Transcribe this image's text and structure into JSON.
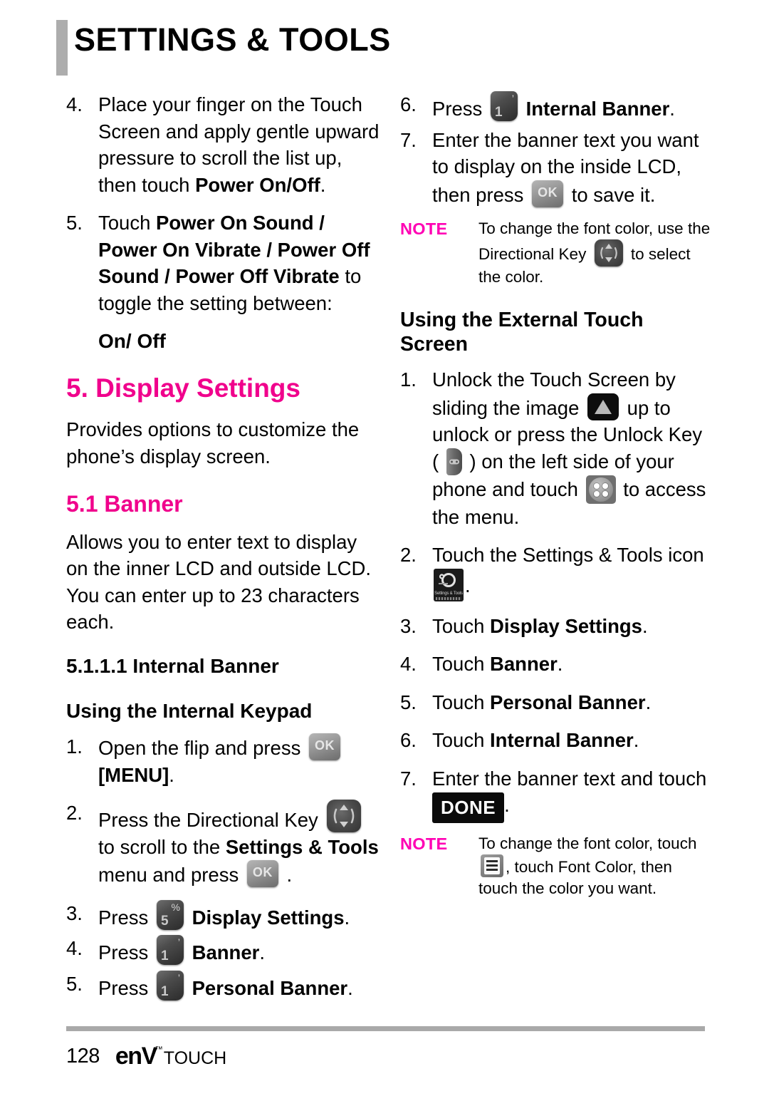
{
  "header": {
    "title": "SETTINGS & TOOLS"
  },
  "colors": {
    "accent_magenta": "#F0008C",
    "note_magenta": "#FF00B4",
    "rule_gray": "#A9A9A9"
  },
  "icons": {
    "key_1": {
      "main": "1",
      "sup": "’"
    },
    "key_5": {
      "main": "5",
      "sup": "%"
    },
    "key_ok": {
      "label": "OK"
    },
    "directional_key": "directional-key",
    "unlock_slider": "unlock-slider-triangle",
    "unlock_key": "unlock-key",
    "menu_circle": "menu-circle-four-dots",
    "settings_tools_app": {
      "label": "Settings & Tools"
    },
    "list_menu": "list-menu"
  },
  "left_column": {
    "step4": {
      "num": "4.",
      "t1": "Place your finger on the Touch Screen and apply gentle upward pressure to scroll the list up, then touch ",
      "b1": "Power On/Off",
      "t2": "."
    },
    "step5": {
      "num": "5.",
      "t1": "Touch ",
      "b1": "Power On Sound / Power On Vibrate / Power Off Sound / Power Off Vibrate",
      "t2": " to toggle the setting between:"
    },
    "on_off": "On/ Off",
    "heading_display_settings": "5. Display Settings",
    "display_settings_desc": "Provides options to customize the phone’s display screen.",
    "heading_banner": "5.1 Banner",
    "banner_desc": "Allows you to enter text to display on the inner LCD and outside LCD. You can enter up to 23 characters each.",
    "heading_internal_banner": "5.1.1.1 Internal Banner",
    "heading_using_internal_keypad": "Using the Internal Keypad",
    "k1": {
      "num": "1.",
      "t1": "Open the flip and press ",
      "t2": "",
      "b1": "[MENU]",
      "t3": "."
    },
    "k2": {
      "num": "2.",
      "t1": "Press the Directional Key ",
      "t2": " to scroll to the ",
      "b1": "Settings & Tools",
      "t3": " menu and press ",
      "t4": " ."
    },
    "k3": {
      "num": "3.",
      "t1": "Press ",
      "b1": "Display Settings",
      "t2": "."
    },
    "k4": {
      "num": "4.",
      "t1": "Press ",
      "b1": "Banner",
      "t2": "."
    },
    "k5": {
      "num": "5.",
      "t1": "Press ",
      "b1": "Personal Banner",
      "t2": "."
    }
  },
  "right_column": {
    "k6": {
      "num": "6.",
      "t1": "Press ",
      "b1": "Internal Banner",
      "t2": "."
    },
    "k7": {
      "num": "7.",
      "t1": "Enter the banner text you want to display on the inside LCD, then press ",
      "t2": " to save it."
    },
    "note1": {
      "tag": "NOTE",
      "t1": "To change the font color, use the Directional Key ",
      "t2": " to select the color."
    },
    "heading_external": "Using the External Touch Screen",
    "e1": {
      "num": "1.",
      "t1": "Unlock the Touch Screen by sliding the image ",
      "t2": " up to unlock or press the Unlock Key ( ",
      "t3": " ) on the left side of your phone and touch ",
      "t4": " to access the menu."
    },
    "e2": {
      "num": "2.",
      "t1": "Touch the Settings & Tools icon ",
      "t2": "."
    },
    "e3": {
      "num": "3.",
      "t1": "Touch ",
      "b1": "Display Settings",
      "t2": "."
    },
    "e4": {
      "num": "4.",
      "t1": "Touch ",
      "b1": "Banner",
      "t2": "."
    },
    "e5": {
      "num": "5.",
      "t1": "Touch ",
      "b1": "Personal Banner",
      "t2": "."
    },
    "e6": {
      "num": "6.",
      "t1": "Touch ",
      "b1": "Internal Banner",
      "t2": "."
    },
    "e7": {
      "num": "7.",
      "t1": "Enter the banner text and touch ",
      "done": "DONE",
      "t2": "."
    },
    "note2": {
      "tag": "NOTE",
      "t1": "To change the font color, touch ",
      "t2": ", touch Font Color, then touch the color you want."
    }
  },
  "footer": {
    "page_number": "128",
    "logo_env": "enV",
    "logo_tm": "™",
    "logo_touch": "TOUCH"
  }
}
